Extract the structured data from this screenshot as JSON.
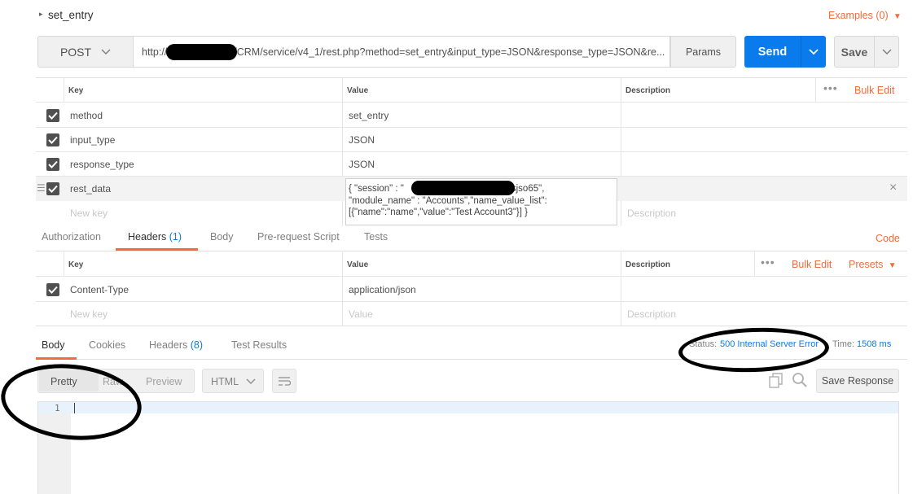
{
  "request": {
    "name": "set_entry",
    "examples_label": "Examples (0)",
    "method": "POST",
    "url_prefix": "http://",
    "url_suffix": "/CRM/service/v4_1/rest.php?method=set_entry&input_type=JSON&response_type=JSON&re...",
    "params_label": "Params",
    "send_label": "Send",
    "save_label": "Save"
  },
  "params_table": {
    "col_key": "Key",
    "col_value": "Value",
    "col_description": "Description",
    "bulk_edit": "Bulk Edit",
    "rows": [
      {
        "key": "method",
        "value": "set_entry"
      },
      {
        "key": "input_type",
        "value": "JSON"
      },
      {
        "key": "response_type",
        "value": "JSON"
      },
      {
        "key": "rest_data",
        "value_line1": "{ \"session\" : \"",
        "value_line1_end": "sjso65\",",
        "value_line2": "\"module_name\" : \"Accounts\",\"name_value_list\":",
        "value_line3": "[{\"name\":\"name\",\"value\":\"Test Account3\"}] }"
      }
    ],
    "new_key_placeholder": "New key",
    "description_placeholder": "Description"
  },
  "request_tabs": {
    "authorization": "Authorization",
    "headers": "Headers",
    "headers_count": "(1)",
    "body": "Body",
    "prerequest": "Pre-request Script",
    "tests": "Tests",
    "code": "Code"
  },
  "headers_table": {
    "col_key": "Key",
    "col_value": "Value",
    "col_description": "Description",
    "bulk_edit": "Bulk Edit",
    "presets": "Presets",
    "rows": [
      {
        "key": "Content-Type",
        "value": "application/json"
      }
    ],
    "new_key_placeholder": "New key",
    "value_placeholder": "Value",
    "description_placeholder": "Description"
  },
  "response": {
    "tabs": {
      "body": "Body",
      "cookies": "Cookies",
      "headers": "Headers",
      "headers_count": "(8)",
      "test_results": "Test Results"
    },
    "status_label": "Status:",
    "status_value": "500 Internal Server Error",
    "time_label": "Time:",
    "time_value": "1508 ms",
    "view_modes": {
      "pretty": "Pretty",
      "raw": "Raw",
      "preview": "Preview"
    },
    "format": "HTML",
    "save_response": "Save Response",
    "line_number": "1"
  },
  "colors": {
    "accent": "#f26b3a",
    "send_blue": "#097bed",
    "link_blue": "#097bed"
  }
}
